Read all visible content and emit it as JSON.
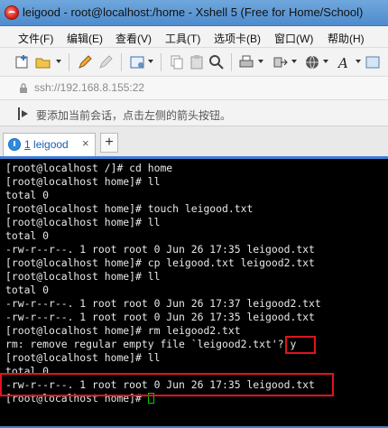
{
  "window": {
    "title": "leigood - root@localhost:/home - Xshell 5 (Free for Home/School)",
    "app_icon": "xshell-logo-icon"
  },
  "menu": [
    {
      "label": "文件(F)"
    },
    {
      "label": "编辑(E)"
    },
    {
      "label": "查看(V)"
    },
    {
      "label": "工具(T)"
    },
    {
      "label": "选项卡(B)"
    },
    {
      "label": "窗口(W)"
    },
    {
      "label": "帮助(H)"
    }
  ],
  "toolbar_icons": [
    "new-session-icon",
    "open-folder-icon",
    "properties-pencil-icon",
    "edit-icon",
    "new-terminal-icon",
    "copy-icon",
    "paste-icon",
    "find-icon",
    "print-icon",
    "transfer-icon",
    "globe-icon",
    "font-icon",
    "more-icon"
  ],
  "address": {
    "value": "ssh://192.168.8.155:22"
  },
  "hint": {
    "text": "要添加当前会话，点击左侧的箭头按钮。"
  },
  "tabs": {
    "active": {
      "number": "1",
      "label": "leigood",
      "close": "×"
    },
    "add": "+"
  },
  "terminal": {
    "lines": [
      "[root@localhost /]# cd home",
      "[root@localhost home]# ll",
      "total 0",
      "[root@localhost home]# touch leigood.txt",
      "[root@localhost home]# ll",
      "total 0",
      "-rw-r--r--. 1 root root 0 Jun 26 17:35 leigood.txt",
      "[root@localhost home]# cp leigood.txt leigood2.txt",
      "[root@localhost home]# ll",
      "total 0",
      "-rw-r--r--. 1 root root 0 Jun 26 17:37 leigood2.txt",
      "-rw-r--r--. 1 root root 0 Jun 26 17:35 leigood.txt",
      "[root@localhost home]# rm leigood2.txt",
      "rm: remove regular empty file `leigood2.txt'? y",
      "[root@localhost home]# ll",
      "total 0",
      "-rw-r--r--. 1 root root 0 Jun 26 17:35 leigood.txt",
      "[root@localhost home]# "
    ],
    "highlight_color": "#e0141c",
    "cursor_color": "#00d000"
  }
}
